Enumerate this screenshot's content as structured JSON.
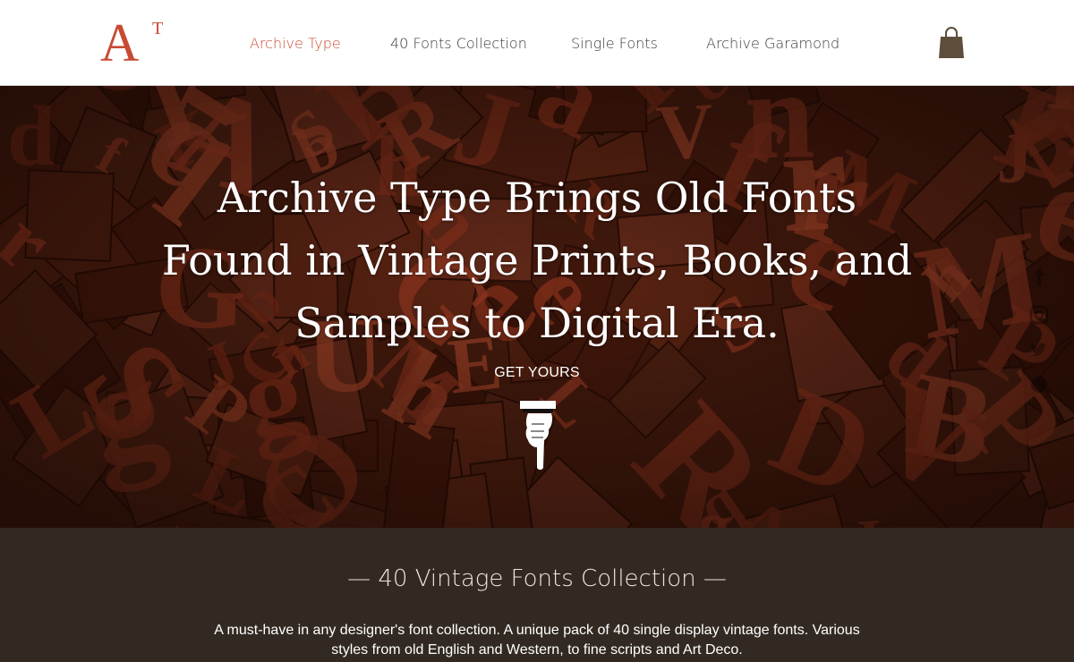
{
  "header": {
    "logo_text": "A",
    "logo_sup": "T",
    "nav": [
      {
        "label": "Archive Type",
        "active": true
      },
      {
        "label": "40 Fonts Collection",
        "active": false
      },
      {
        "label": "Single Fonts",
        "active": false
      },
      {
        "label": "Archive Garamond",
        "active": false
      }
    ],
    "cart_icon": "shopping-bag-icon"
  },
  "hero": {
    "title_lines": [
      "Archive Type Brings Old Fonts",
      "Found in Vintage Prints, Books, and",
      "Samples to Digital Era."
    ],
    "cta_label": "GET YOURS",
    "cta_icon": "pointing-hand-icon",
    "social_icons": [
      "facebook-icon",
      "instagram-icon",
      "twitter-icon",
      "pinterest-icon"
    ]
  },
  "collection": {
    "title": "— 40 Vintage Fonts Collection —",
    "description": "A must-have in any designer's font collection. A unique pack of 40 single display vintage fonts. Various styles from old English and Western, to fine scripts and Art Deco."
  },
  "colors": {
    "accent": "#c94a34",
    "nav_text": "#3a3a3a",
    "hero_bg": "#3e1a0f",
    "section_bg": "#322a22",
    "cart": "#5d4d3b"
  }
}
